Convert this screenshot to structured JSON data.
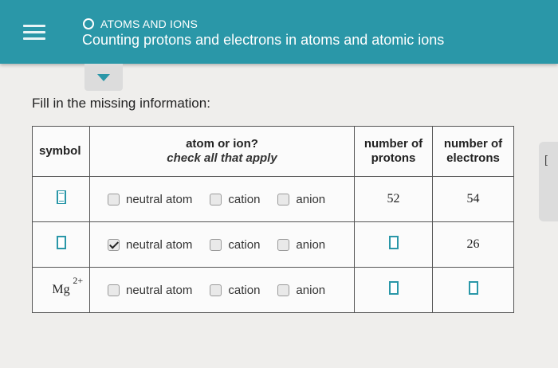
{
  "header": {
    "topic": "ATOMS AND IONS",
    "title": "Counting protons and electrons in atoms and atomic ions",
    "accent_color": "#2a97a8"
  },
  "instruction": "Fill in the missing information:",
  "table": {
    "headers": {
      "symbol": "symbol",
      "atom_or_ion": "atom or ion?",
      "atom_or_ion_sub": "check all that apply",
      "protons": "number of protons",
      "protons_l1": "number of",
      "protons_l2": "protons",
      "electrons_l1": "number of",
      "electrons_l2": "electrons"
    },
    "option_labels": [
      "neutral atom",
      "cation",
      "anion"
    ],
    "rows": [
      {
        "symbol": "",
        "symbol_charge": "",
        "checked": [
          false,
          false,
          false
        ],
        "protons": "52",
        "electrons": "54"
      },
      {
        "symbol": "",
        "symbol_charge": "",
        "checked": [
          true,
          false,
          false
        ],
        "protons": "",
        "electrons": "26"
      },
      {
        "symbol": "Mg",
        "symbol_charge": "2+",
        "checked": [
          false,
          false,
          false
        ],
        "protons": "",
        "electrons": ""
      }
    ]
  },
  "icons": {
    "menu": "hamburger-menu-icon",
    "topic": "circle-icon",
    "dropdown": "triangle-down-icon"
  }
}
